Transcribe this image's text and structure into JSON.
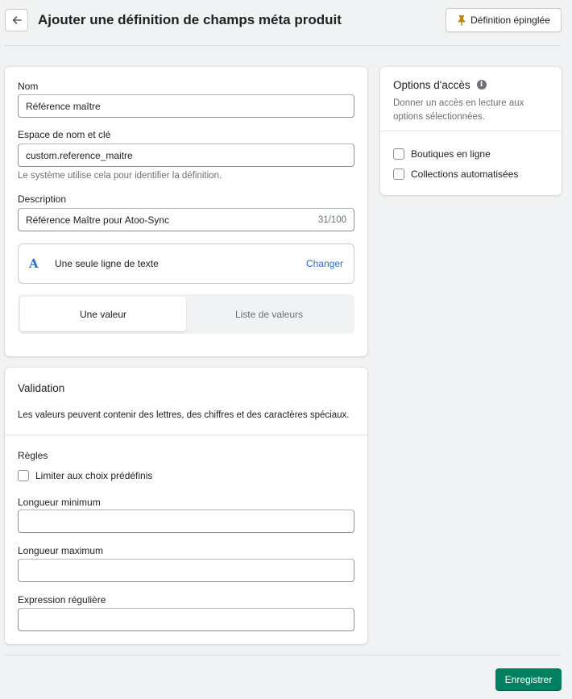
{
  "header": {
    "title": "Ajouter une définition de champs méta produit",
    "pin_label": "Définition épinglée"
  },
  "form": {
    "name_label": "Nom",
    "name_value": "Référence maître",
    "namespace_label": "Espace de nom et clé",
    "namespace_value": "custom.reference_maitre",
    "namespace_help": "Le système utilise cela pour identifier la définition.",
    "description_label": "Description",
    "description_value": "Référence Maître pour Atoo-Sync",
    "description_counter": "31/100",
    "type_icon_letter": "A",
    "type_label": "Une seule ligne de texte",
    "type_change": "Changer",
    "seg_one": "Une valeur",
    "seg_list": "Liste de valeurs"
  },
  "validation": {
    "title": "Validation",
    "description": "Les valeurs peuvent contenir des lettres, des chiffres et des caractères spéciaux.",
    "rules_label": "Règles",
    "limit_label": "Limiter aux choix prédéfinis",
    "min_label": "Longueur minimum",
    "min_value": "",
    "max_label": "Longueur maximum",
    "max_value": "",
    "regex_label": "Expression régulière",
    "regex_value": ""
  },
  "access": {
    "title": "Options d'accès",
    "description": "Donner un accès en lecture aux options sélectionnées.",
    "options": [
      "Boutiques en ligne",
      "Collections automatisées"
    ]
  },
  "footer": {
    "save_label": "Enregistrer"
  },
  "colors": {
    "primary": "#008060",
    "link": "#2c6ecb"
  }
}
